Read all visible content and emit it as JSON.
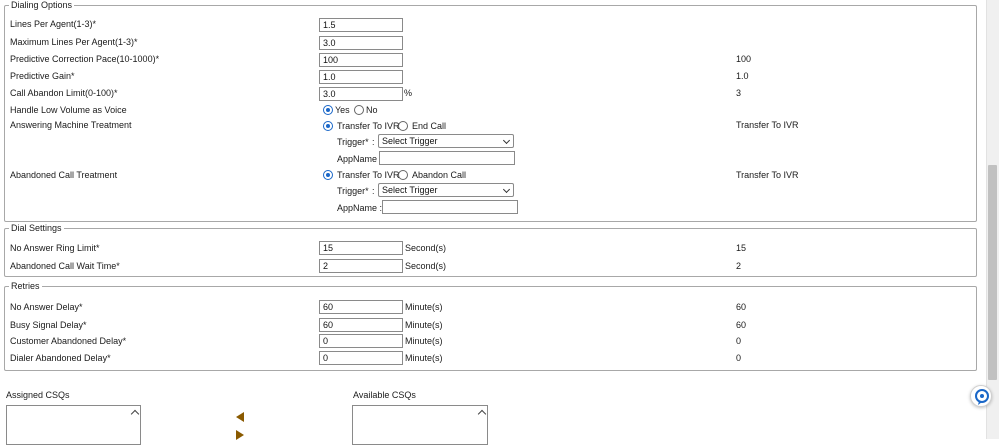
{
  "dialing_options": {
    "legend": "Dialing Options",
    "lines_per_agent": {
      "label": "Lines Per Agent(1-3)*",
      "value": "1.5"
    },
    "max_lines_per_agent": {
      "label": "Maximum Lines Per Agent(1-3)*",
      "value": "3.0"
    },
    "predictive_correction_pace": {
      "label": "Predictive Correction Pace(10-1000)*",
      "value": "100",
      "current": "100"
    },
    "predictive_gain": {
      "label": "Predictive Gain*",
      "value": "1.0",
      "current": "1.0"
    },
    "call_abandon_limit": {
      "label": "Call Abandon Limit(0-100)*",
      "value": "3.0",
      "unit": "%",
      "current": "3"
    },
    "handle_low_volume": {
      "label": "Handle Low Volume as Voice",
      "yes": "Yes",
      "no": "No",
      "selected": "Yes"
    },
    "answering_machine": {
      "label": "Answering Machine Treatment",
      "option1": "Transfer To IVR",
      "option2": "End Call",
      "selected": "Transfer To IVR",
      "current": "Transfer To IVR",
      "trigger_label": "Trigger*",
      "trigger_sep": ":",
      "trigger_value": "Select Trigger",
      "appname_label": "AppName",
      "appname_value": ""
    },
    "abandoned_call": {
      "label": "Abandoned Call Treatment",
      "option1": "Transfer To IVR",
      "option2": "Abandon Call",
      "selected": "Transfer To IVR",
      "current": "Transfer To IVR",
      "trigger_label": "Trigger*",
      "trigger_sep": ":",
      "trigger_value": "Select Trigger",
      "appname_label": "AppName :",
      "appname_value": ""
    }
  },
  "dial_settings": {
    "legend": "Dial Settings",
    "no_answer_ring_limit": {
      "label": "No Answer Ring Limit*",
      "value": "15",
      "unit": "Second(s)",
      "current": "15"
    },
    "abandoned_call_wait_time": {
      "label": "Abandoned Call Wait Time*",
      "value": "2",
      "unit": "Second(s)",
      "current": "2"
    }
  },
  "retries": {
    "legend": "Retries",
    "no_answer_delay": {
      "label": "No Answer Delay*",
      "value": "60",
      "unit": "Minute(s)",
      "current": "60"
    },
    "busy_signal_delay": {
      "label": "Busy Signal Delay*",
      "value": "60",
      "unit": "Minute(s)",
      "current": "60"
    },
    "customer_abandoned_delay": {
      "label": "Customer Abandoned Delay*",
      "value": "0",
      "unit": "Minute(s)",
      "current": "0"
    },
    "dialer_abandoned_delay": {
      "label": "Dialer Abandoned Delay*",
      "value": "0",
      "unit": "Minute(s)",
      "current": "0"
    }
  },
  "csqs": {
    "assigned_label": "Assigned CSQs",
    "available_label": "Available CSQs"
  },
  "icons": {
    "move_left": "arrow-left-icon",
    "move_right": "arrow-right-icon",
    "help": "help-chat-icon"
  },
  "colors": {
    "radio_accent": "#1a67c8",
    "arrow": "#8a5a00",
    "help_icon": "#1a67c8"
  }
}
